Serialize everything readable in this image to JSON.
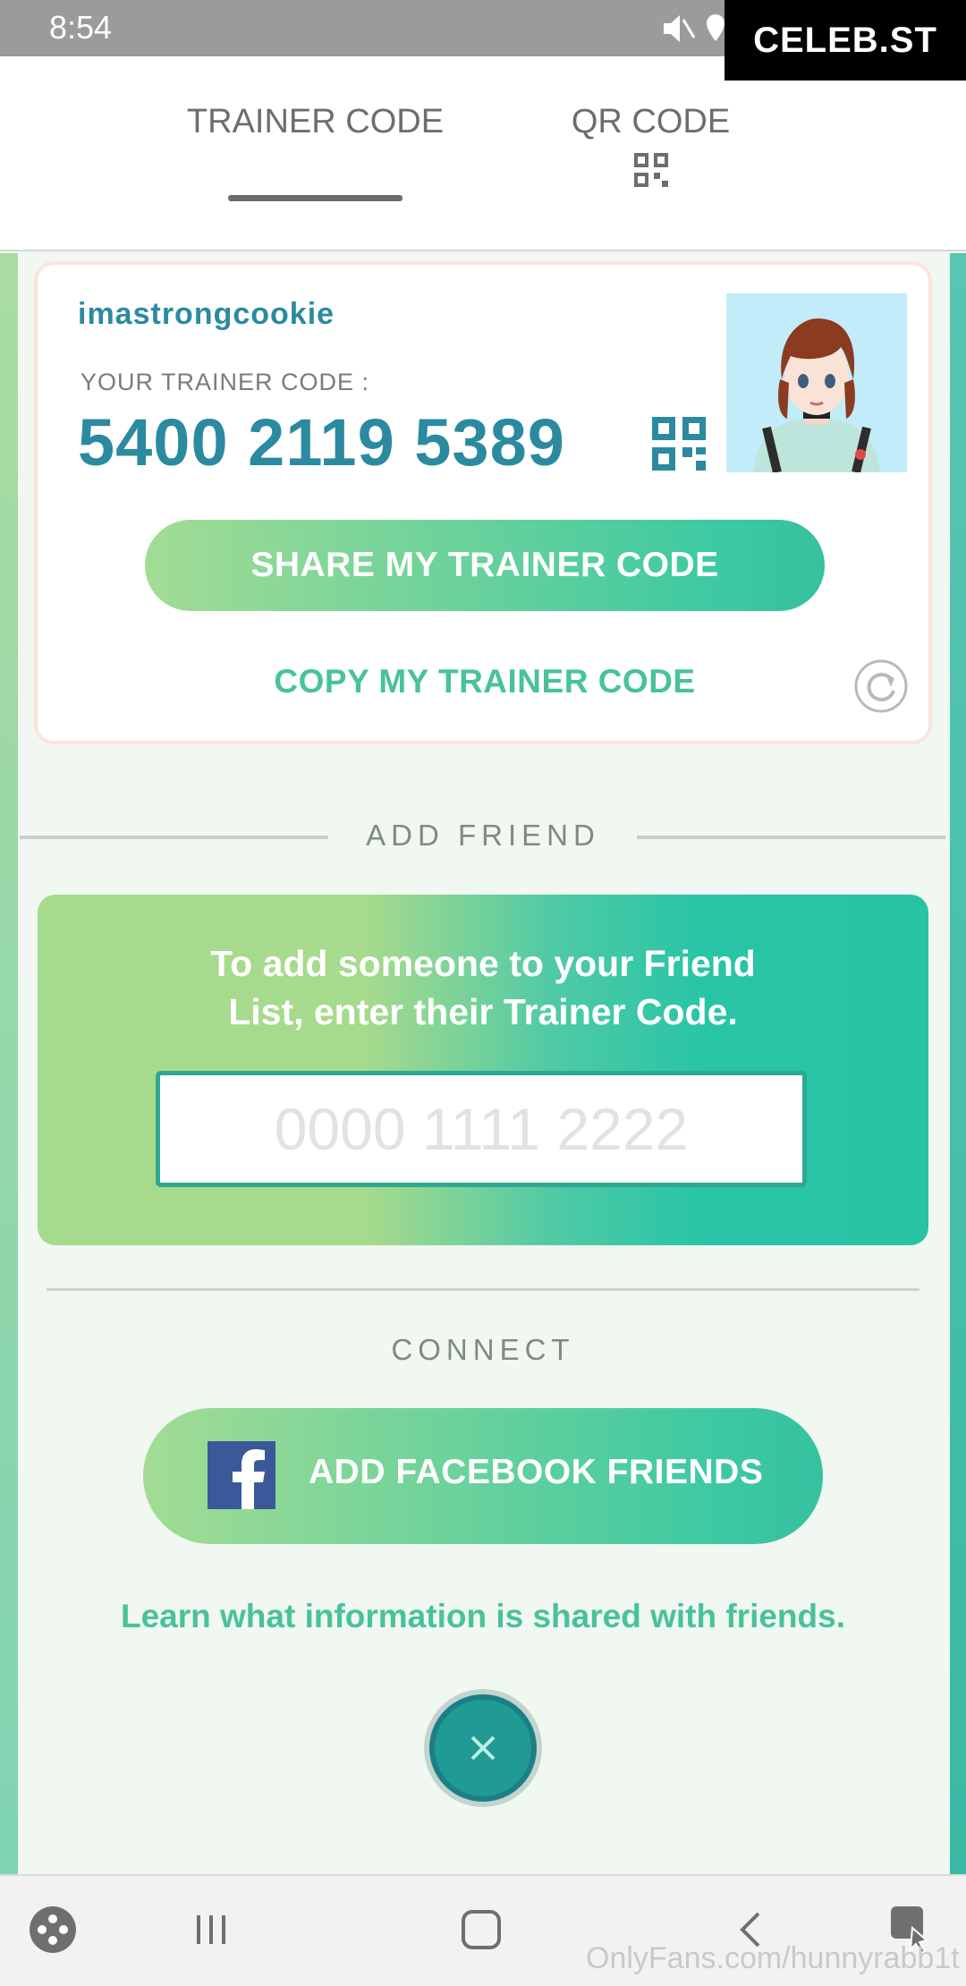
{
  "status_bar": {
    "time": "8:54",
    "icons": [
      "mute-icon",
      "location-icon"
    ],
    "overlay_logo": "CELEB.ST"
  },
  "tabs": [
    {
      "label": "TRAINER CODE",
      "active": true
    },
    {
      "label": "QR CODE",
      "active": false,
      "icon": "qr-code-icon"
    }
  ],
  "trainer_card": {
    "username": "imastrongcookie",
    "code_label": "YOUR TRAINER CODE :",
    "code_value": "5400 2119 5389",
    "share_button": "SHARE MY TRAINER CODE",
    "copy_link": "COPY MY TRAINER CODE",
    "refresh_icon": "refresh-icon",
    "avatar_icon": "trainer-avatar"
  },
  "add_friend": {
    "title": "ADD FRIEND",
    "instructions_line1": "To add someone to your Friend",
    "instructions_line2": "List, enter their Trainer Code.",
    "input_placeholder": "0000 1111 2222",
    "input_value": ""
  },
  "connect": {
    "title": "CONNECT",
    "facebook_button": "ADD FACEBOOK FRIENDS",
    "learn_link": "Learn what information is shared with friends."
  },
  "close_icon": "close-icon",
  "nav_bar": {
    "items": [
      "game-launcher-icon",
      "recents-icon",
      "home-icon",
      "back-icon",
      "assistant-icon"
    ]
  },
  "watermark": "OnlyFans.com/hunnyrabb1t",
  "colors": {
    "accent_teal": "#2b8aa0",
    "button_green_start": "#a3dc94",
    "button_green_end": "#3cc9a2",
    "link_green": "#48c29b",
    "facebook_blue": "#3b5998"
  }
}
